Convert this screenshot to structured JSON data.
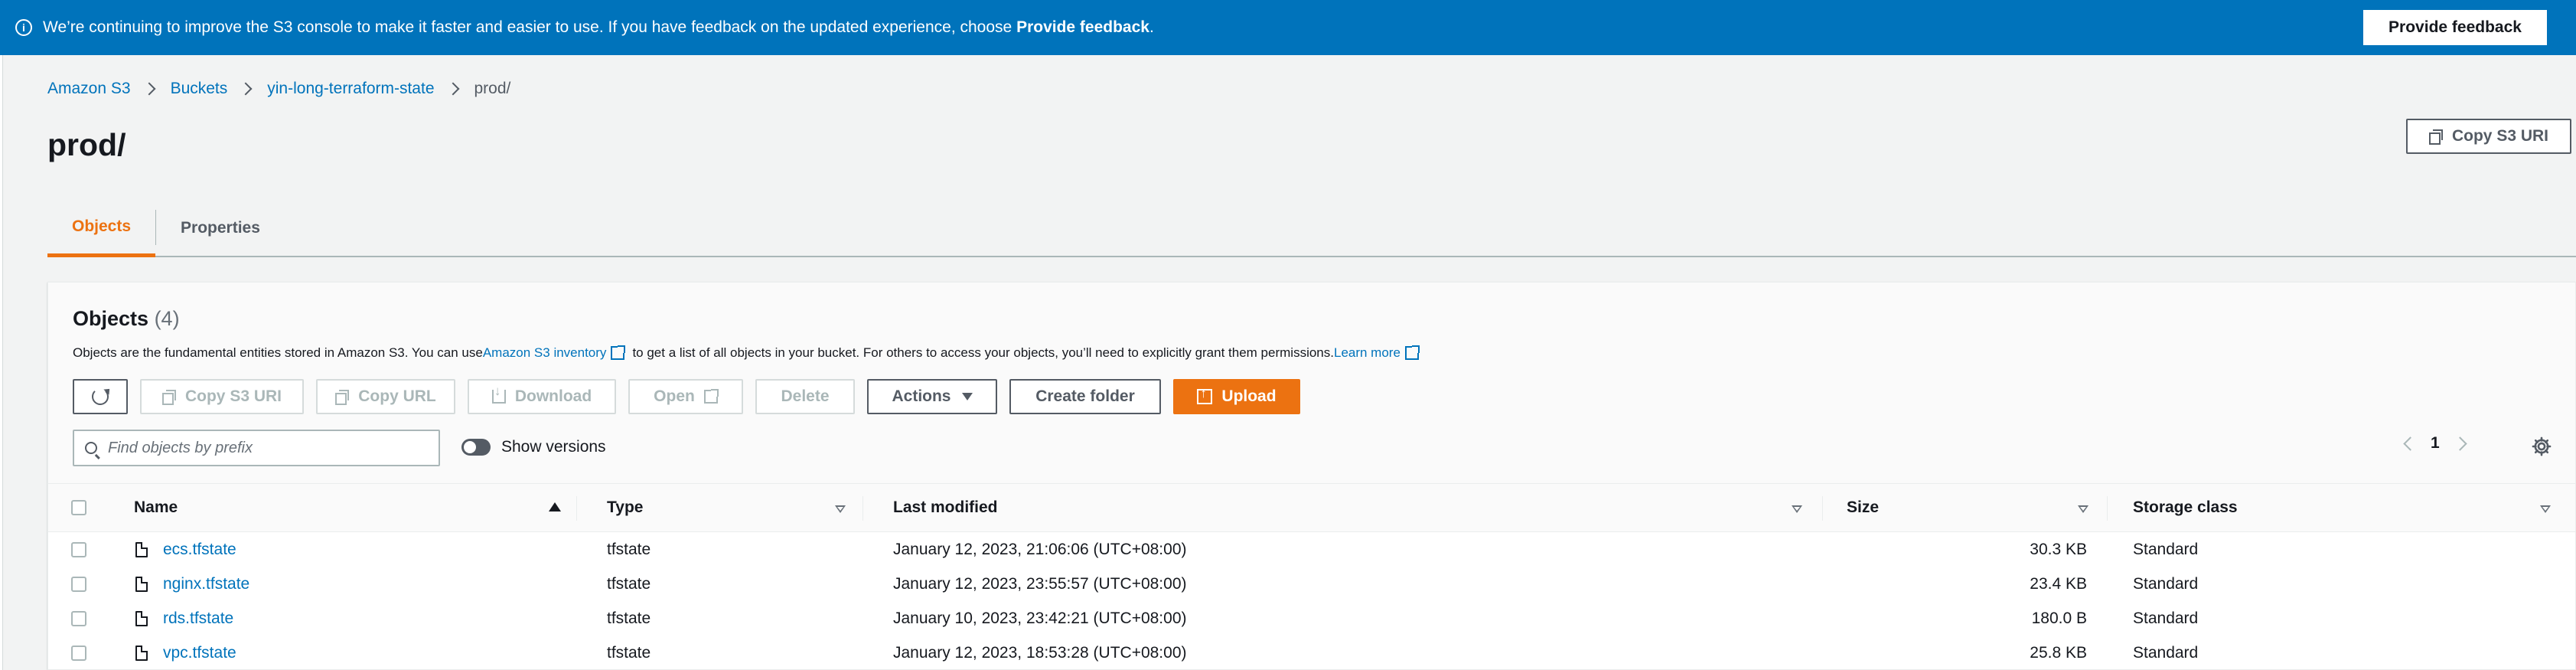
{
  "banner": {
    "text": "We’re continuing to improve the S3 console to make it faster and easier to use. If you have feedback on the updated experience, choose ",
    "text_bold": "Provide feedback",
    "text_end": ".",
    "button": "Provide feedback"
  },
  "breadcrumb": [
    "Amazon S3",
    "Buckets",
    "yin-long-terraform-state",
    "prod/"
  ],
  "page": {
    "title": "prod/",
    "copy_uri": "Copy S3 URI"
  },
  "tabs": [
    "Objects",
    "Properties"
  ],
  "objects": {
    "title": "Objects",
    "count": "(4)",
    "desc_1": "Objects are the fundamental entities stored in Amazon S3. You can use ",
    "desc_link": "Amazon S3 inventory",
    "desc_2": " to get a list of all objects in your bucket. For others to access your objects, you’ll need to explicitly grant them permissions. ",
    "learn_more": "Learn more",
    "toolbar": {
      "copy_uri": "Copy S3 URI",
      "copy_url": "Copy URL",
      "download": "Download",
      "open": "Open",
      "delete": "Delete",
      "actions": "Actions",
      "create_folder": "Create folder",
      "upload": "Upload"
    },
    "search_placeholder": "Find objects by prefix",
    "show_versions": "Show versions",
    "page_number": "1",
    "columns": [
      "Name",
      "Type",
      "Last modified",
      "Size",
      "Storage class"
    ],
    "rows": [
      {
        "name": "ecs.tfstate",
        "type": "tfstate",
        "modified": "January 12, 2023, 21:06:06 (UTC+08:00)",
        "size": "30.3 KB",
        "storage": "Standard"
      },
      {
        "name": "nginx.tfstate",
        "type": "tfstate",
        "modified": "January 12, 2023, 23:55:57 (UTC+08:00)",
        "size": "23.4 KB",
        "storage": "Standard"
      },
      {
        "name": "rds.tfstate",
        "type": "tfstate",
        "modified": "January 10, 2023, 23:42:21 (UTC+08:00)",
        "size": "180.0 B",
        "storage": "Standard"
      },
      {
        "name": "vpc.tfstate",
        "type": "tfstate",
        "modified": "January 12, 2023, 18:53:28 (UTC+08:00)",
        "size": "25.8 KB",
        "storage": "Standard"
      }
    ]
  },
  "colors": {
    "banner": "#0073bb",
    "accent": "#ec7211",
    "link": "#0073bb"
  }
}
